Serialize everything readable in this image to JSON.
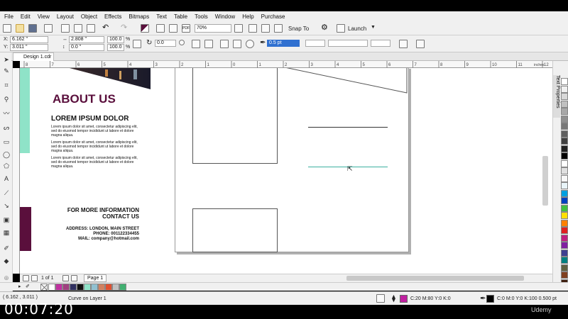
{
  "menu": [
    "File",
    "Edit",
    "View",
    "Layout",
    "Object",
    "Effects",
    "Bitmaps",
    "Text",
    "Table",
    "Tools",
    "Window",
    "Help",
    "Purchase"
  ],
  "toolbar1": {
    "zoom": "70%",
    "snap_label": "Snap To",
    "launch_label": "Launch"
  },
  "toolbar2": {
    "x_label": "X:",
    "x_value": "6.162 \"",
    "y_label": "Y:",
    "y_value": "3.011 \"",
    "w_value": "2.808 \"",
    "h_value": "0.0 \"",
    "scale_w": "100.0",
    "scale_h": "100.0",
    "pct1": "%",
    "pct2": "%",
    "angle": "0.0",
    "outline_width": "0.5 pt"
  },
  "document_tab": "Design 1.cdr",
  "ruler_unit": "inches",
  "ruler_ticks": [
    "8",
    "7",
    "6",
    "5",
    "4",
    "3",
    "2",
    "1",
    "0",
    "1",
    "2",
    "3",
    "4",
    "5",
    "6",
    "7",
    "8",
    "9",
    "10",
    "11",
    "12"
  ],
  "flyer": {
    "about_title": "ABOUT US",
    "lorem_title": "LOREM IPSUM DOLOR",
    "paragraphs": [
      "Lorem ipsum dolor sit amet, consectetur adipiscing elit, sed do eiusmod tempor incididunt ut labore et dolore magna aliqua.",
      "Lorem ipsum dolor sit amet, consectetur adipiscing elit, sed do eiusmod tempor incididunt ut labore et dolore magna aliqua.",
      "Lorem ipsum dolor sit amet, consectetur adipiscing elit, sed do eiusmod tempor incididunt ut labore et dolore magna aliqua."
    ],
    "info_line1": "FOR MORE INFORMATION",
    "info_line2": "CONTACT US",
    "address": "ADDRESS: LONDON, MAIN STREET",
    "phone": "PHONE:  001122334455",
    "mail": "MAIL:   company@hotmail.com"
  },
  "page_nav": {
    "page_count": "1 of 1",
    "page_tab": "Page 1"
  },
  "right_panel_label": "Text Properties",
  "status": {
    "coords": "( 6.162 , 3.011 )",
    "message": "Curve on Layer 1",
    "fill_label": "C:20 M:80 Y:0 K:0",
    "outline_label": "C:0 M:0 Y:0 K:100  0.500 pt"
  },
  "timer": "00:07:20",
  "watermark": "Udemy",
  "colors": {
    "accent_purple": "#5a0f3c",
    "mint": "#8fe3c8",
    "selected_fill": "#c020a0",
    "teal_line": "#3bb0a0"
  },
  "bottom_palette": [
    "#ffffff",
    "#c030a0",
    "#a04080",
    "#303060",
    "#101010",
    "#8fe3c8",
    "#90c0d0",
    "#d08060",
    "#e05030",
    "#c0c0c0",
    "#40b070"
  ],
  "right_palette": [
    "#ffffff",
    "#f0f0f0",
    "#d8d8d8",
    "#c0c0c0",
    "#a8a8a8",
    "#909090",
    "#787878",
    "#606060",
    "#404040",
    "#202020",
    "#000000",
    "#ffffff",
    "#e0e0e0",
    "#f8f8f8",
    "#e8f4f8",
    "#00a0e0",
    "#0040c0",
    "#40c040",
    "#ffe000",
    "#ff8000",
    "#e02020",
    "#c02080",
    "#8020a0",
    "#404090",
    "#008080",
    "#606040",
    "#804020",
    "#402010"
  ]
}
